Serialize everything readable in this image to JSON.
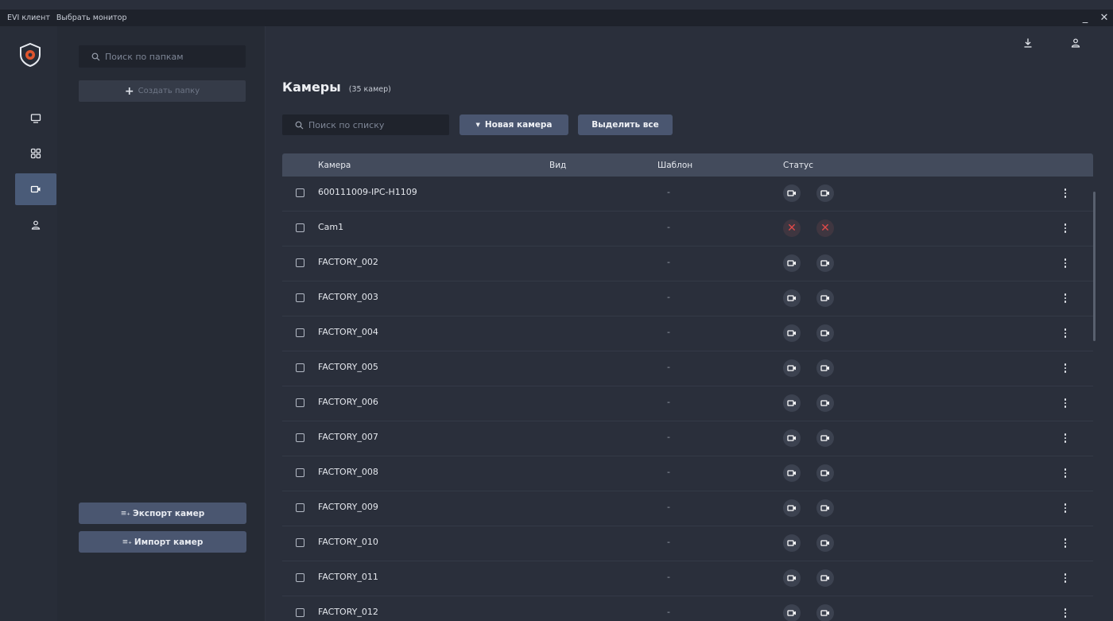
{
  "titlebar": {
    "app_label": "EVI клиент",
    "monitor_label": "Выбрать монитор",
    "minimize": "_",
    "close": "✕"
  },
  "rail": {
    "items": [
      {
        "icon": "monitor-icon",
        "active": false
      },
      {
        "icon": "grid-icon",
        "active": false
      },
      {
        "icon": "camera-icon",
        "active": true
      },
      {
        "icon": "user-icon",
        "active": false
      }
    ]
  },
  "folders": {
    "search_placeholder": "Поиск по папкам",
    "create_label": "Создать папку",
    "export_label": "Экспорт камер",
    "import_label": "Импорт камер"
  },
  "main": {
    "title": "Камеры",
    "count": "(35 камер)",
    "search_placeholder": "Поиск по списку",
    "new_camera_label": "Новая камера",
    "select_all_label": "Выделить все",
    "columns": [
      "Камера",
      "Вид",
      "Шаблон",
      "Статус"
    ],
    "rows": [
      {
        "name": "600111009-IPC-H1109",
        "template": "-",
        "status": [
          "ok",
          "ok"
        ]
      },
      {
        "name": "Cam1",
        "template": "-",
        "status": [
          "error",
          "error"
        ]
      },
      {
        "name": "FACTORY_002",
        "template": "-",
        "status": [
          "ok",
          "ok"
        ]
      },
      {
        "name": "FACTORY_003",
        "template": "-",
        "status": [
          "ok",
          "ok"
        ]
      },
      {
        "name": "FACTORY_004",
        "template": "-",
        "status": [
          "ok",
          "ok"
        ]
      },
      {
        "name": "FACTORY_005",
        "template": "-",
        "status": [
          "ok",
          "ok"
        ]
      },
      {
        "name": "FACTORY_006",
        "template": "-",
        "status": [
          "ok",
          "ok"
        ]
      },
      {
        "name": "FACTORY_007",
        "template": "-",
        "status": [
          "ok",
          "ok"
        ]
      },
      {
        "name": "FACTORY_008",
        "template": "-",
        "status": [
          "ok",
          "ok"
        ]
      },
      {
        "name": "FACTORY_009",
        "template": "-",
        "status": [
          "ok",
          "ok"
        ]
      },
      {
        "name": "FACTORY_010",
        "template": "-",
        "status": [
          "ok",
          "ok"
        ]
      },
      {
        "name": "FACTORY_011",
        "template": "-",
        "status": [
          "ok",
          "ok"
        ]
      },
      {
        "name": "FACTORY_012",
        "template": "-",
        "status": [
          "ok",
          "ok"
        ]
      }
    ]
  },
  "colors": {
    "accent": "#4a5670",
    "active_rail": "#4a5b78",
    "error": "#e04a4a",
    "logo": "#e0552e"
  }
}
